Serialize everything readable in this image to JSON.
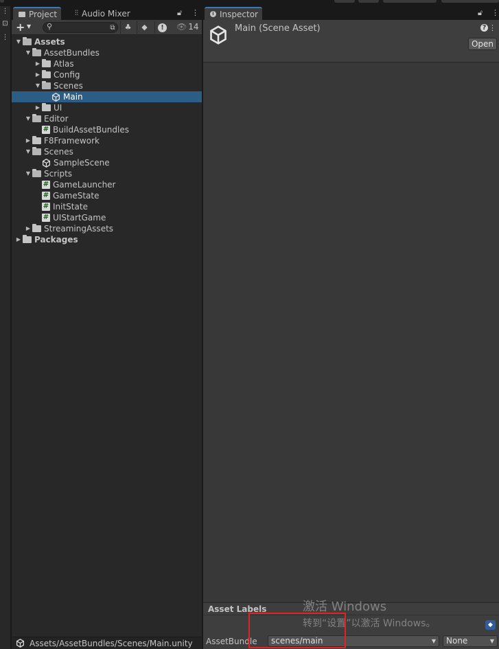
{
  "project_panel": {
    "tabs": [
      {
        "label": "Project",
        "icon": "folder-icon"
      },
      {
        "label": "Audio Mixer",
        "icon": "mixer-icon"
      }
    ],
    "visible_count": "14",
    "status_path": "Assets/AssetBundles/Scenes/Main.unity",
    "tree": [
      {
        "label": "Assets",
        "depth": 0,
        "icon": "folder-open-icon",
        "expanded": true,
        "bold": true
      },
      {
        "label": "AssetBundles",
        "depth": 1,
        "icon": "folder-open-icon",
        "expanded": true
      },
      {
        "label": "Atlas",
        "depth": 2,
        "icon": "folder-icon",
        "expanded": false
      },
      {
        "label": "Config",
        "depth": 2,
        "icon": "folder-icon",
        "expanded": false
      },
      {
        "label": "Scenes",
        "depth": 2,
        "icon": "folder-open-icon",
        "expanded": true
      },
      {
        "label": "Main",
        "depth": 3,
        "icon": "unity-scene-icon",
        "selected": true
      },
      {
        "label": "UI",
        "depth": 2,
        "icon": "folder-icon",
        "expanded": false
      },
      {
        "label": "Editor",
        "depth": 1,
        "icon": "folder-open-icon",
        "expanded": true
      },
      {
        "label": "BuildAssetBundles",
        "depth": 2,
        "icon": "csharp-script-icon"
      },
      {
        "label": "F8Framework",
        "depth": 1,
        "icon": "folder-icon",
        "expanded": false
      },
      {
        "label": "Scenes",
        "depth": 1,
        "icon": "folder-open-icon",
        "expanded": true
      },
      {
        "label": "SampleScene",
        "depth": 2,
        "icon": "unity-scene-icon"
      },
      {
        "label": "Scripts",
        "depth": 1,
        "icon": "folder-open-icon",
        "expanded": true
      },
      {
        "label": "GameLauncher",
        "depth": 2,
        "icon": "csharp-script-icon"
      },
      {
        "label": "GameState",
        "depth": 2,
        "icon": "csharp-script-icon"
      },
      {
        "label": "InitState",
        "depth": 2,
        "icon": "csharp-script-icon"
      },
      {
        "label": "UIStartGame",
        "depth": 2,
        "icon": "csharp-script-icon"
      },
      {
        "label": "StreamingAssets",
        "depth": 1,
        "icon": "folder-icon",
        "expanded": false
      },
      {
        "label": "Packages",
        "depth": 0,
        "icon": "folder-icon",
        "expanded": false,
        "bold": true
      }
    ]
  },
  "inspector": {
    "tab_label": "Inspector",
    "title": "Main (Scene Asset)",
    "open_button": "Open",
    "asset_labels_title": "Asset Labels",
    "asset_bundle_label": "AssetBundle",
    "asset_bundle_value": "scenes/main",
    "variant_value": "None"
  },
  "watermark": {
    "line1": "激活 Windows",
    "line2": "转到“设置”以激活 Windows。"
  },
  "colors": {
    "selection": "#2c5d87",
    "tab_accent": "#3a79bb",
    "highlight_box": "#e02424"
  }
}
